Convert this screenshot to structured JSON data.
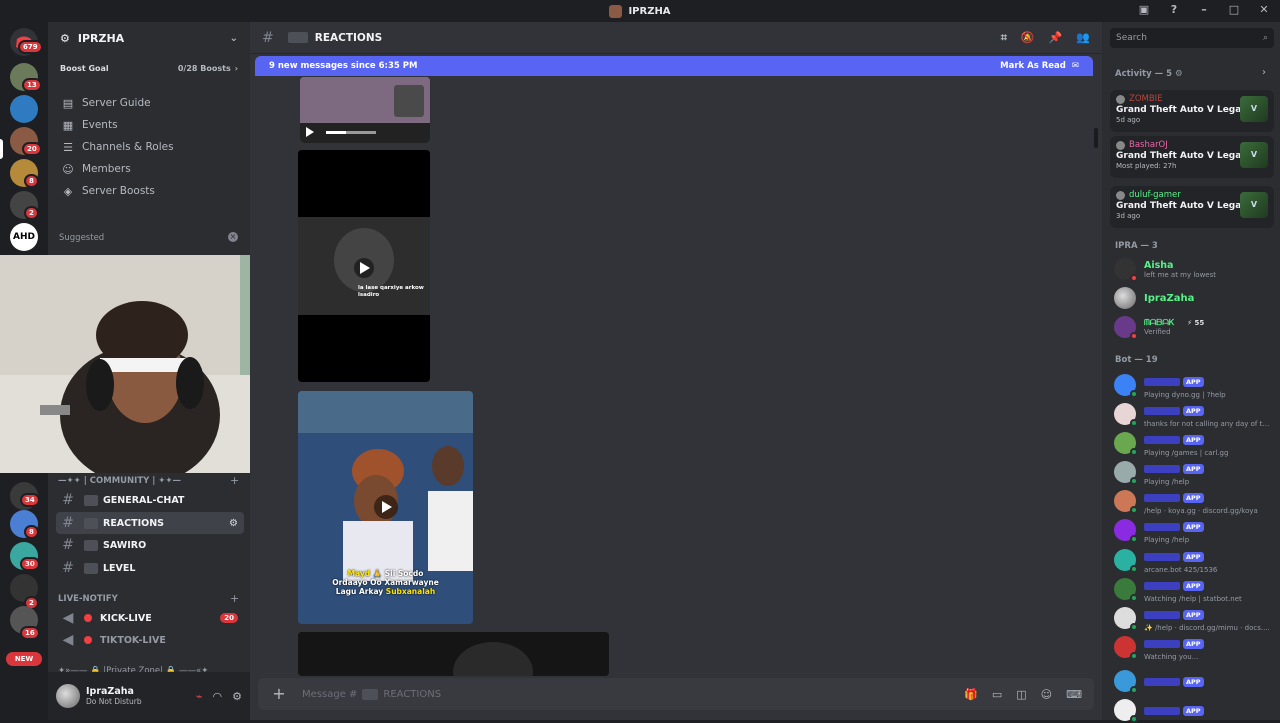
{
  "window": {
    "title": "IPRZHA"
  },
  "guilds": {
    "home_badge": "679",
    "badges": [
      "13",
      "20",
      "8",
      "2",
      "34",
      "8",
      "30",
      "2",
      "16"
    ],
    "text_icon": "AHD",
    "new_label": "NEW"
  },
  "server": {
    "name": "IPRZHA",
    "boost_goal": "Boost Goal",
    "boost_count": "0/28 Boosts",
    "nav": [
      "Server Guide",
      "Events",
      "Channels & Roles",
      "Members",
      "Server Boosts"
    ],
    "suggested": "Suggested",
    "community_cat": "—✦✦ | COMMUNITY | ✦✦—",
    "channels": [
      {
        "name": "GENERAL-CHAT"
      },
      {
        "name": "REACTIONS"
      },
      {
        "name": "SAWIRO"
      },
      {
        "name": "LEVEL"
      }
    ],
    "live_cat": "LIVE-NOTIFY",
    "live": [
      {
        "name": "KICK-LIVE",
        "badge": "20"
      },
      {
        "name": "TIKTOK-LIVE"
      }
    ],
    "private_cat": "✦»—— 🔒 |Private Zone| 🔒 ——«✦"
  },
  "user": {
    "name": "IpraZaha",
    "status": "Do Not Disturb"
  },
  "chat": {
    "channel": "REACTIONS",
    "banner": "9 new messages since 6:35 PM",
    "mark_read": "Mark As Read",
    "placeholder": "Message #",
    "placeholder_channel": "REACTIONS",
    "video_caption_1": "Mayd",
    "video_caption_2": "Sii Socdo",
    "video_caption_3": "Ordaayo Oo Xamarwayne",
    "video_caption_4": "Lagu Arkay",
    "video_caption_5": "Subxanalah",
    "video_small_caption": "la lase qarxiye arkow lsadiro"
  },
  "right": {
    "search": "Search",
    "activity": "Activity — 5",
    "activities": [
      {
        "user": "ZOMBIE",
        "game": "Grand Theft Auto V Legacy",
        "time": "5d ago"
      },
      {
        "user": "BasharOJ",
        "game": "Grand Theft Auto V Legacy",
        "time": "Most played: 27h"
      },
      {
        "user": "duluf-gamer",
        "game": "Grand Theft Auto V Legacy",
        "time": "3d ago"
      }
    ],
    "ipra_header": "IPRA — 3",
    "members": [
      {
        "name": "Aisha",
        "sub": "left me at my lowest"
      },
      {
        "name": "IpraZaha",
        "sub": ""
      },
      {
        "name": "ᗰᗩᗷᗩᏦ",
        "sub": "Verified",
        "extra": "⚡ 55"
      }
    ],
    "bot_header": "Bot — 19",
    "app_label": "APP",
    "bots": [
      "Playing dyno.gg | ?help",
      "thanks for not calling any day of th...",
      "Playing /games | carl.gg",
      "Playing /help",
      "/help · koya.gg · discord.gg/koya",
      "Playing /help",
      "arcane.bot 425/1536",
      "Watching /help | statbot.net",
      "✨ /help · discord.gg/mimu · docs....",
      "Watching you...",
      "",
      ""
    ]
  }
}
